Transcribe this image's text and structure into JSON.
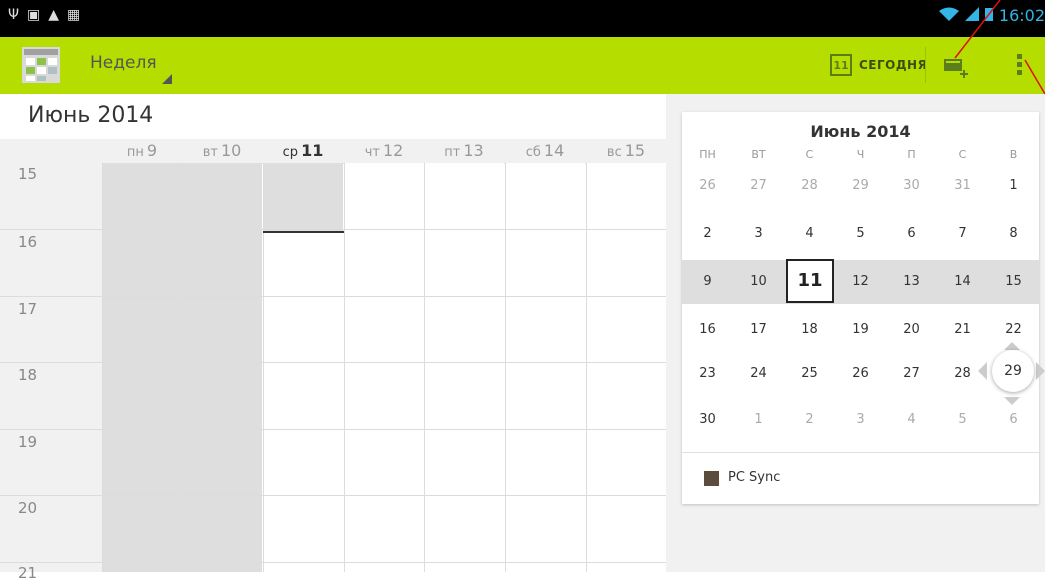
{
  "status_bar": {
    "left_icons": [
      "usb-icon",
      "image-icon",
      "warning-icon",
      "briefcase-icon"
    ],
    "time": "16:02"
  },
  "action_bar": {
    "view_label": "Неделя",
    "today_label": "СЕГОДНЯ",
    "today_icon_number": "11",
    "accent_color": "#b6dd00"
  },
  "main": {
    "month_title": "Июнь 2014",
    "days": [
      {
        "dow": "пн",
        "num": "9"
      },
      {
        "dow": "вт",
        "num": "10"
      },
      {
        "dow": "ср",
        "num": "11"
      },
      {
        "dow": "чт",
        "num": "12"
      },
      {
        "dow": "пт",
        "num": "13"
      },
      {
        "dow": "сб",
        "num": "14"
      },
      {
        "dow": "вс",
        "num": "15"
      }
    ],
    "today_index": 2,
    "hours": [
      "15",
      "16",
      "17",
      "18",
      "19",
      "20",
      "21"
    ]
  },
  "mini_calendar": {
    "title": "Июнь 2014",
    "dow": [
      "ПН",
      "ВТ",
      "С",
      "Ч",
      "П",
      "С",
      "В"
    ],
    "weeks": [
      [
        "26",
        "27",
        "28",
        "29",
        "30",
        "31",
        "1"
      ],
      [
        "2",
        "3",
        "4",
        "5",
        "6",
        "7",
        "8"
      ],
      [
        "9",
        "10",
        "11",
        "12",
        "13",
        "14",
        "15"
      ],
      [
        "16",
        "17",
        "18",
        "19",
        "20",
        "21",
        "22"
      ],
      [
        "23",
        "24",
        "25",
        "26",
        "27",
        "28",
        "29"
      ],
      [
        "30",
        "1",
        "2",
        "3",
        "4",
        "5",
        "6"
      ]
    ],
    "today": "11",
    "calendar_name": "PC Sync",
    "calendar_color": "#5b4c3c"
  }
}
